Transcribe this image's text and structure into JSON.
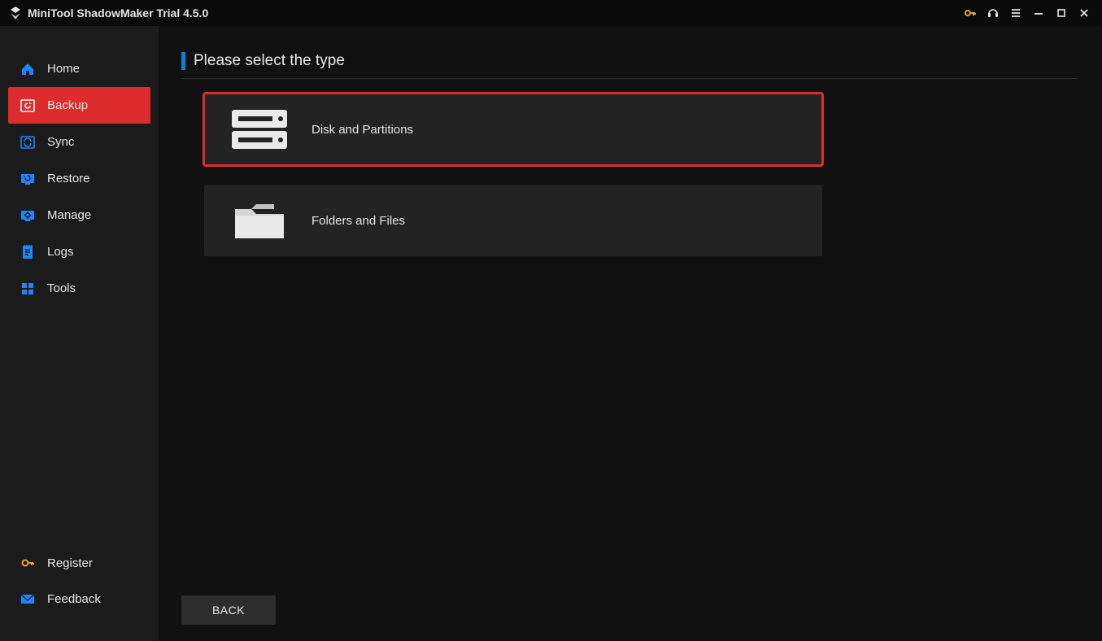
{
  "titlebar": {
    "appTitle": "MiniTool ShadowMaker Trial 4.5.0"
  },
  "sidebar": {
    "items": [
      {
        "label": "Home",
        "icon": "home-icon",
        "active": false
      },
      {
        "label": "Backup",
        "icon": "backup-icon",
        "active": true
      },
      {
        "label": "Sync",
        "icon": "sync-icon",
        "active": false
      },
      {
        "label": "Restore",
        "icon": "restore-icon",
        "active": false
      },
      {
        "label": "Manage",
        "icon": "manage-icon",
        "active": false
      },
      {
        "label": "Logs",
        "icon": "logs-icon",
        "active": false
      },
      {
        "label": "Tools",
        "icon": "tools-icon",
        "active": false
      }
    ],
    "bottom": [
      {
        "label": "Register",
        "icon": "key-icon"
      },
      {
        "label": "Feedback",
        "icon": "mail-icon"
      }
    ]
  },
  "page": {
    "title": "Please select the type",
    "options": [
      {
        "label": "Disk and Partitions",
        "icon": "disk-icon",
        "highlight": true
      },
      {
        "label": "Folders and Files",
        "icon": "folder-icon",
        "highlight": false
      }
    ],
    "backLabel": "BACK"
  },
  "colors": {
    "accentBlue": "#0b7fdc",
    "sidebarBlue": "#1d86ff",
    "activeRed": "#de2b2b",
    "keyGold": "#e8a71a"
  }
}
